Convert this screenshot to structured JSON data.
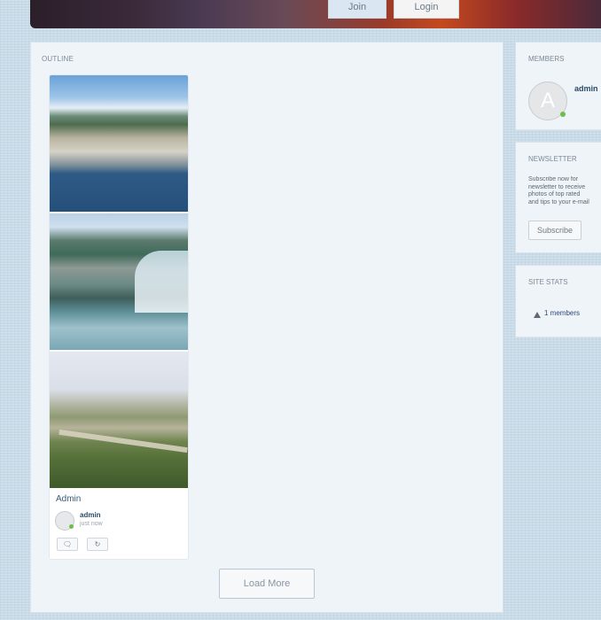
{
  "header": {
    "join_label": "Join",
    "login_label": "Login"
  },
  "main": {
    "outline_title": "OUTLINE",
    "card": {
      "author": "Admin",
      "comment_user": "admin",
      "comment_time": "just now"
    },
    "load_more_label": "Load More"
  },
  "members": {
    "title": "MEMBERS",
    "avatar_letter": "A",
    "name": "admin"
  },
  "newsletter": {
    "title": "NEWSLETTER",
    "lines": [
      "Subscribe now for",
      "newsletter to receive",
      "photos of top rated",
      "and tips to your e-mail"
    ],
    "subscribe_label": "Subscribe"
  },
  "site_stats": {
    "title": "SITE STATS",
    "members_text": "1 members"
  },
  "icons": {
    "comment": "comment-icon",
    "repin": "repin-icon",
    "user": "user-icon"
  },
  "colors": {
    "accent": "#2a4a6a",
    "online": "#6cc04a",
    "panel_bg": "#eef4f8"
  }
}
